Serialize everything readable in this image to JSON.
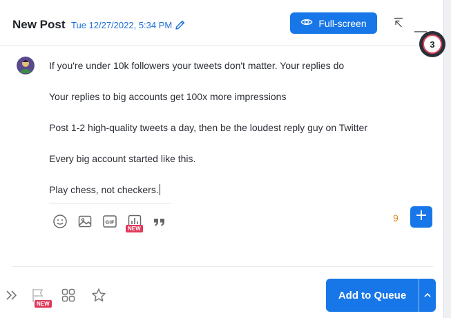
{
  "header": {
    "title": "New Post",
    "date": "Tue 12/27/2022, 5:34 PM",
    "fullscreen_label": "Full-screen",
    "notification_count": "3"
  },
  "post": {
    "lines": [
      "If you're under 10k followers your tweets don't matter. Your replies do",
      "Your replies to big accounts get 100x more impressions",
      "Post 1-2 high-quality tweets a day, then be the loudest reply guy on Twitter",
      "Every big account started like this.",
      "Play chess, not checkers."
    ],
    "char_count": "9"
  },
  "toolbar": {
    "icons": [
      "emoji-icon",
      "image-icon",
      "gif-icon",
      "poll-icon",
      "quote-icon"
    ],
    "poll_badge": "NEW"
  },
  "footer": {
    "flag_badge": "NEW",
    "queue_label": "Add to Queue"
  },
  "colors": {
    "accent": "#1877e8",
    "badge_red": "#e0385a",
    "count_orange": "#e08a1e"
  }
}
